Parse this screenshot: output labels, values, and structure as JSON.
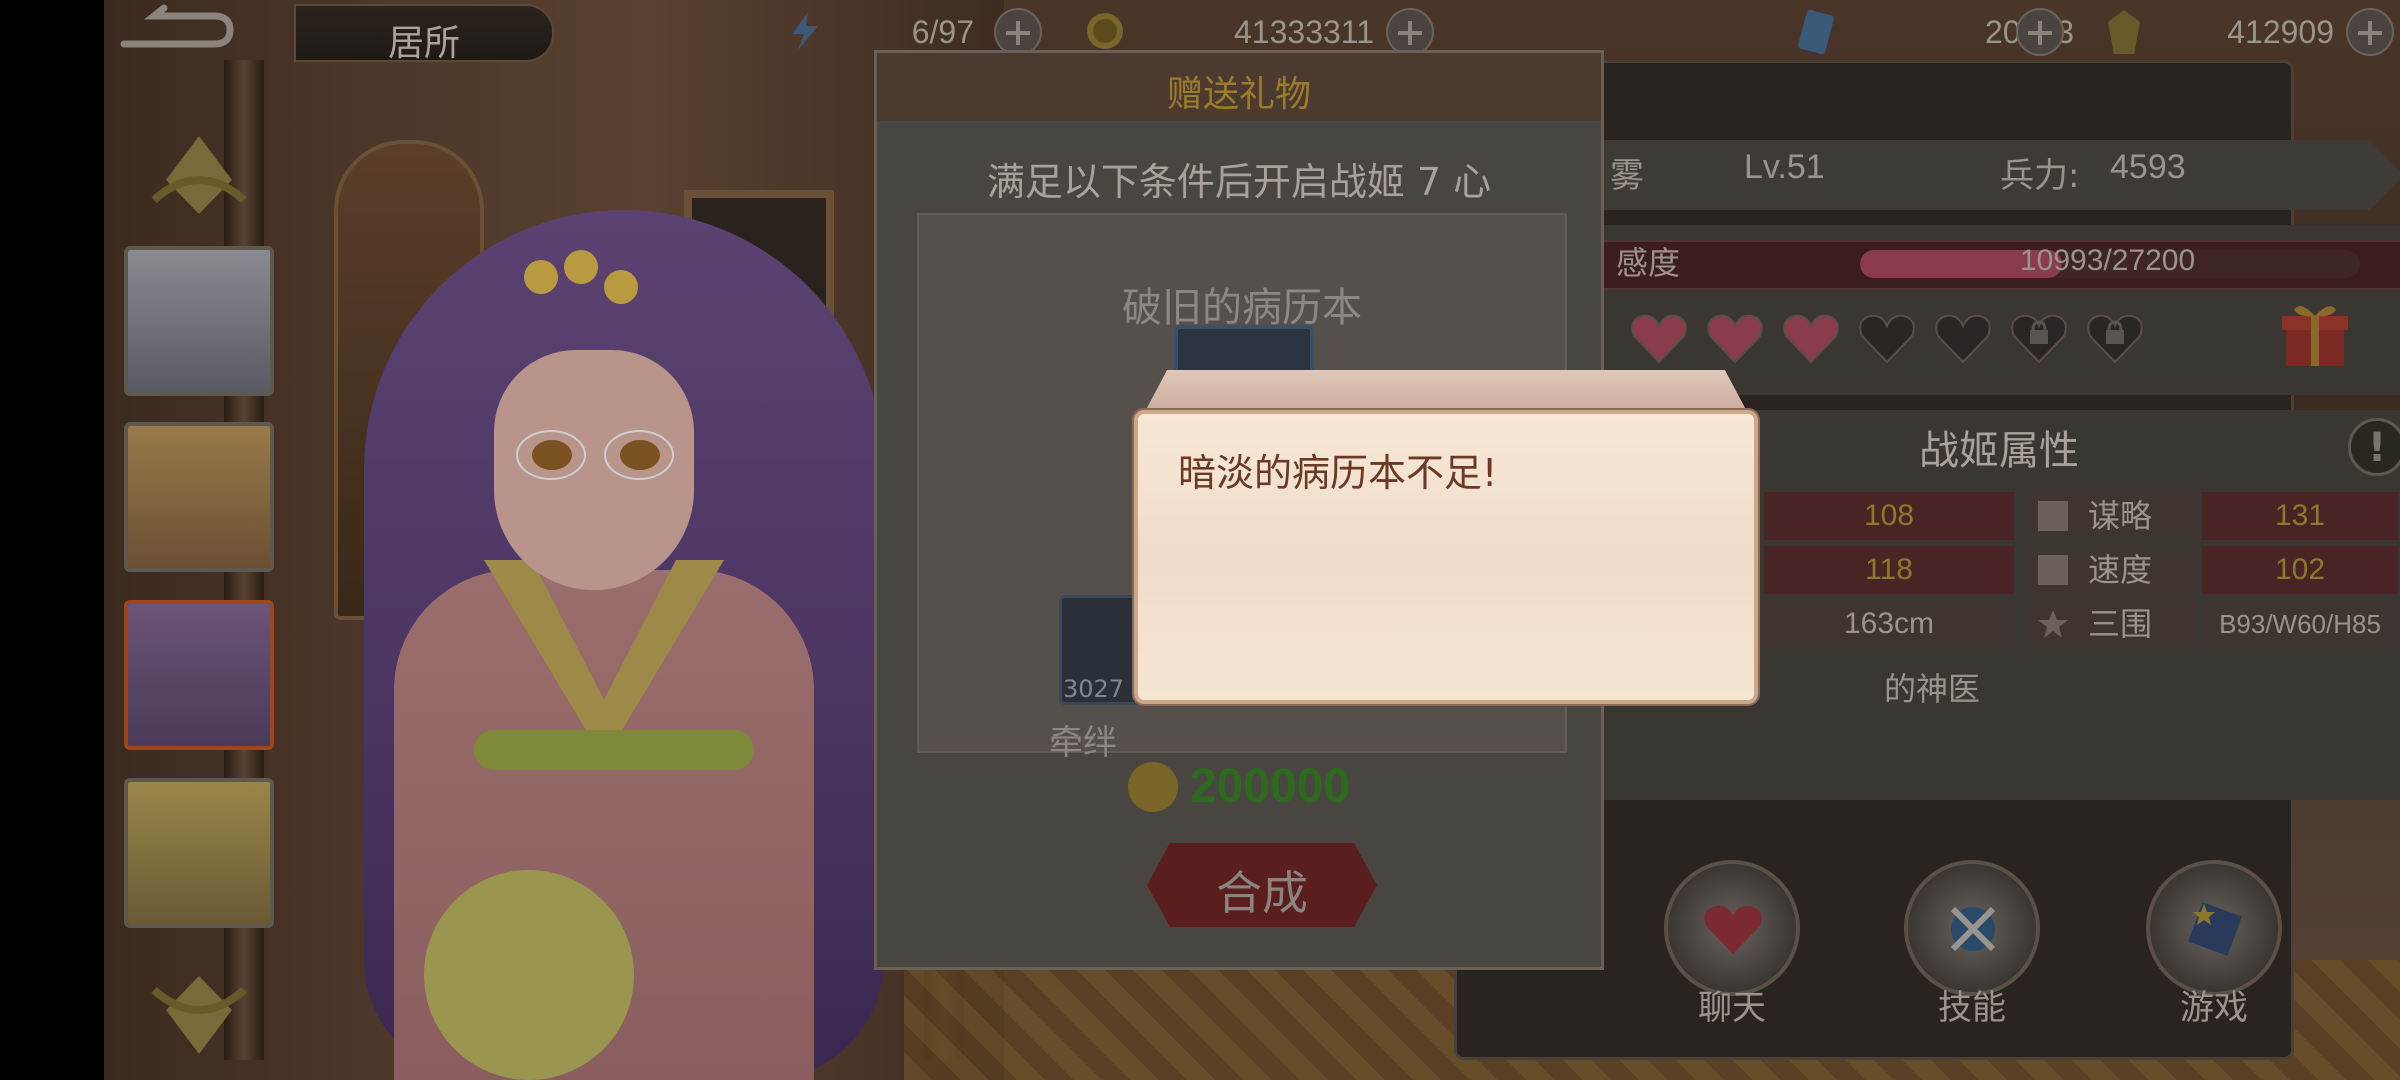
{
  "nav": {
    "title": "居所"
  },
  "resources": [
    {
      "icon": "lightning-icon",
      "value": "6/97"
    },
    {
      "icon": "coin-icon",
      "value": "41333311"
    },
    {
      "icon": "crystal-icon",
      "value": "20043"
    },
    {
      "icon": "gem-icon",
      "value": "412909"
    }
  ],
  "profile": {
    "name_fragment": "雾",
    "level": "Lv.51",
    "power_label": "兵力:",
    "power_value": "4593",
    "affection_label": "感度",
    "affection_value": "10993/27200",
    "affection_fraction": 0.404,
    "hearts": {
      "filled": 3,
      "empty": 2,
      "locked": 2
    }
  },
  "attributes": {
    "title": "战姬属性",
    "rows": [
      {
        "left_value": "108",
        "right_label": "谋略",
        "right_value": "131"
      },
      {
        "left_value": "118",
        "right_label": "速度",
        "right_value": "102"
      },
      {
        "left_value": "163cm",
        "right_label": "三围",
        "right_value": "B93/W60/H85"
      }
    ],
    "description_fragment": "的神医"
  },
  "actions": [
    {
      "icon": "chat-heart-icon",
      "label": "聊天"
    },
    {
      "icon": "skill-icon",
      "label": "技能"
    },
    {
      "icon": "game-icon",
      "label": "游戏"
    }
  ],
  "gift_dialog": {
    "header": "赠送礼物",
    "condition": "满足以下条件后开启战姬 7 心",
    "item_name": "破旧的病历本",
    "material_count": "3027",
    "material_name_fragment": "牵绊",
    "cost": "200000",
    "synth_label": "合成"
  },
  "toast": {
    "message": "暗淡的病历本不足!"
  },
  "colors": {
    "accent_red": "#8a3c4a",
    "cost_green": "#2e6a1e",
    "toast_text": "#6a3a26"
  }
}
